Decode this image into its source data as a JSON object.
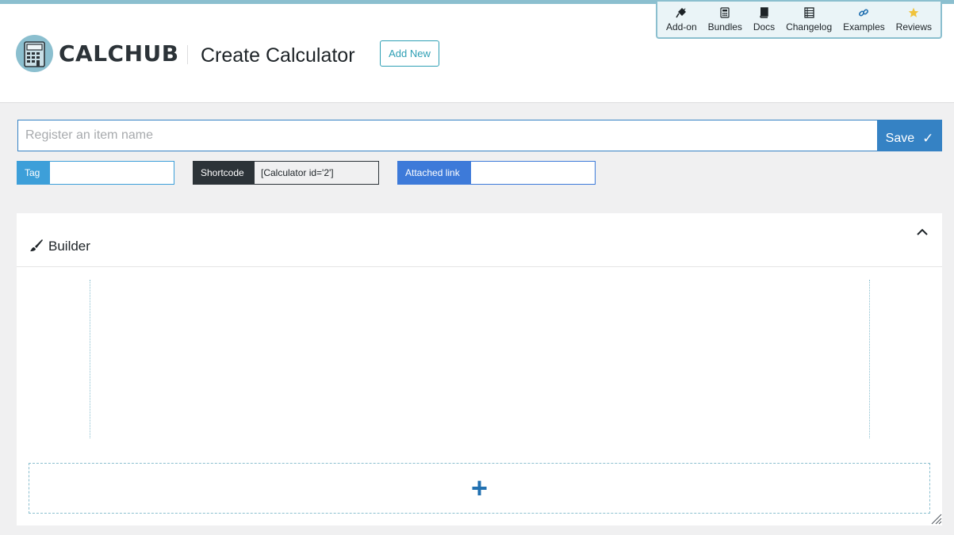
{
  "header": {
    "brand": "CALCHUB",
    "page_title": "Create Calculator",
    "add_new_label": "Add New"
  },
  "top_menu": {
    "items": [
      {
        "label": "Add-on",
        "icon": "plug-icon"
      },
      {
        "label": "Bundles",
        "icon": "calculator-icon"
      },
      {
        "label": "Docs",
        "icon": "book-icon"
      },
      {
        "label": "Changelog",
        "icon": "list-icon"
      },
      {
        "label": "Examples",
        "icon": "link-icon"
      },
      {
        "label": "Reviews",
        "icon": "star-icon"
      }
    ]
  },
  "form": {
    "name_placeholder": "Register an item name",
    "name_value": "",
    "save_label": "Save",
    "save_icon": "✓",
    "tag_label": "Tag",
    "tag_value": "",
    "shortcode_label": "Shortcode",
    "shortcode_value": "[Calculator id='2']",
    "attached_link_label": "Attached link",
    "attached_link_value": ""
  },
  "builder": {
    "title": "Builder",
    "add_icon": "+"
  },
  "colors": {
    "accent": "#8bbfcf",
    "primary": "#3582c4",
    "tag": "#3d9fd9",
    "shortcode": "#2c3338",
    "link": "#3d7ad9",
    "star": "#f0c33c"
  }
}
